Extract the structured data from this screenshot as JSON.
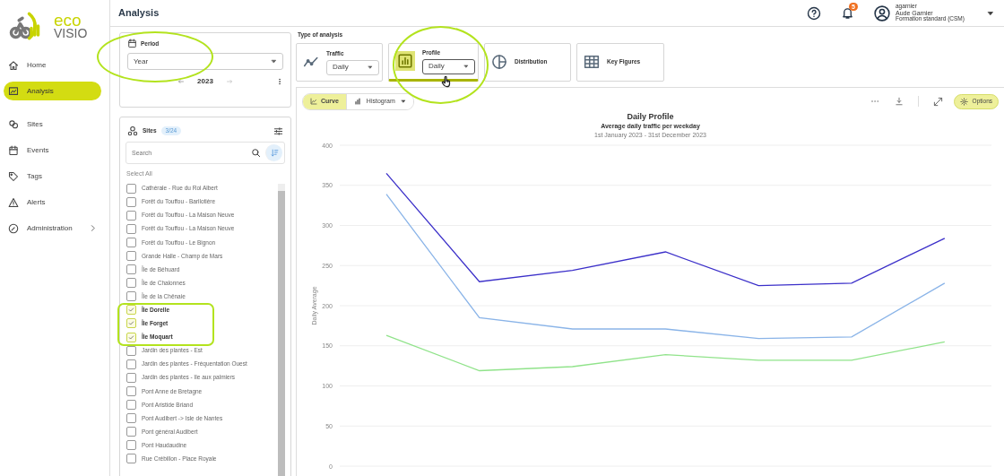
{
  "logo": {
    "top": "eco",
    "bottom": "VISIO"
  },
  "sidebar": {
    "items": [
      {
        "kind": "home",
        "label": "Home",
        "selected": false,
        "expandable": false
      },
      {
        "kind": "analysis",
        "label": "Analysis",
        "selected": true,
        "expandable": false
      },
      {
        "kind": "sites",
        "label": "Sites",
        "selected": false,
        "expandable": false
      },
      {
        "kind": "events",
        "label": "Events",
        "selected": false,
        "expandable": false
      },
      {
        "kind": "tags",
        "label": "Tags",
        "selected": false,
        "expandable": false
      },
      {
        "kind": "alerts",
        "label": "Alerts",
        "selected": false,
        "expandable": false
      },
      {
        "kind": "administration",
        "label": "Administration",
        "selected": false,
        "expandable": true
      }
    ]
  },
  "header": {
    "title": "Analysis",
    "notifications": "5",
    "user": {
      "login": "agarnier",
      "name": "Aude Garnier",
      "role": "Formation standard (CSM)"
    }
  },
  "period": {
    "label": "Period",
    "value": "Year",
    "year": "2023"
  },
  "sites": {
    "label": "Sites",
    "count": "3/24",
    "search_placeholder": "Search",
    "select_all": "Select All",
    "items": [
      {
        "label": "Cathérale - Rue du Roi Albert",
        "checked": false
      },
      {
        "label": "Forêt du Touffou - Barilotière",
        "checked": false
      },
      {
        "label": "Forêt du Touffou - La Maison Neuve",
        "checked": false
      },
      {
        "label": "Forêt du Touffou - La Maison Neuve",
        "checked": false
      },
      {
        "label": "Forêt du Touffou - Le Bignon",
        "checked": false
      },
      {
        "label": "Grande Halle - Champ de Mars",
        "checked": false
      },
      {
        "label": "Île de Béhuard",
        "checked": false
      },
      {
        "label": "Île de Chalonnes",
        "checked": false
      },
      {
        "label": "Île de la Chênaie",
        "checked": false
      },
      {
        "label": "Île Dorelle",
        "checked": true
      },
      {
        "label": "Île Forget",
        "checked": true
      },
      {
        "label": "Île Moquart",
        "checked": true
      },
      {
        "label": "Jardin des plantes - Est",
        "checked": false
      },
      {
        "label": "Jardin des plantes - Fréquentation Ouest",
        "checked": false
      },
      {
        "label": "Jardin des plantes - île aux palmiers",
        "checked": false
      },
      {
        "label": "Pont Anne de Bretagne",
        "checked": false
      },
      {
        "label": "Pont Aristide Briand",
        "checked": false
      },
      {
        "label": "Pont Audibert -> Isle de Nantes",
        "checked": false
      },
      {
        "label": "Pont général Audibert",
        "checked": false
      },
      {
        "label": "Pont Haudaudine",
        "checked": false
      },
      {
        "label": "Rue Crébillon - Place Royale",
        "checked": false
      }
    ]
  },
  "analysis_types": {
    "label": "Type of analysis",
    "items": [
      {
        "kind": "traffic",
        "label": "Traffic",
        "dropdown": "Daily",
        "selected": false
      },
      {
        "kind": "profile",
        "label": "Profile",
        "dropdown": "Daily",
        "selected": true
      },
      {
        "kind": "distribution",
        "label": "Distribution",
        "selected": false
      },
      {
        "kind": "key_figures",
        "label": "Key Figures",
        "selected": false
      }
    ]
  },
  "chart_view": {
    "tabs": [
      {
        "kind": "curve",
        "label": "Curve",
        "selected": true
      },
      {
        "kind": "histogram",
        "label": "Histogram",
        "selected": false
      }
    ],
    "options": "Options"
  },
  "chart": {
    "subtitle": "Average daily traffic per weekday",
    "date_range": "1st January 2023 - 31st December 2023",
    "chart_data": {
      "type": "line",
      "grid": true,
      "title": "Daily Profile",
      "ylabel": "Daily Average",
      "ylim": [
        0,
        400
      ],
      "yticks": [
        0,
        50,
        100,
        150,
        200,
        250,
        300,
        350,
        400
      ],
      "series": [
        {
          "color": "#3b2fc9",
          "values": [
            365,
            230,
            244,
            267,
            225,
            228,
            284
          ]
        },
        {
          "color": "#8ab4e8",
          "values": [
            339,
            185,
            171,
            171,
            159,
            161,
            228
          ]
        },
        {
          "color": "#90e38a",
          "values": [
            163,
            119,
            124,
            139,
            132,
            132,
            155
          ]
        }
      ]
    }
  }
}
